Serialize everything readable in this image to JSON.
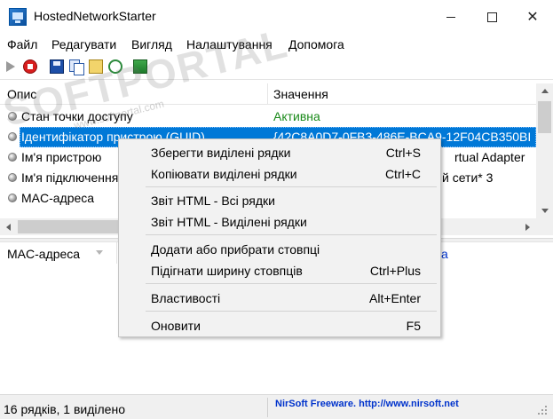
{
  "window": {
    "title": "HostedNetworkStarter",
    "controls": {
      "minimize": "minimize",
      "maximize": "maximize",
      "close": "close"
    }
  },
  "menu": {
    "items": [
      "Файл",
      "Редагувати",
      "Вигляд",
      "Налаштування",
      "Допомога"
    ]
  },
  "toolbar": {
    "icons": [
      "play-icon",
      "stop-icon",
      "save-icon",
      "copy-icon",
      "properties-icon",
      "refresh-icon",
      "exit-icon"
    ]
  },
  "list": {
    "columns": [
      "Опис",
      "Значення"
    ],
    "rows": [
      {
        "desc": "Стан точки доступу",
        "value": "Активна"
      },
      {
        "desc": "Ідентифікатор пристрою (GUID)",
        "value": "{42C8A0D7-0FB3-486E-BCA9-12F04CB350BI"
      },
      {
        "desc": "Ім'я пристрою",
        "value": "rtual Adapter"
      },
      {
        "desc": "Ім'я підключення",
        "value": "й сети* 3"
      },
      {
        "desc": "MAC-адреса",
        "value": ""
      }
    ],
    "status_color": "#1a8a1a",
    "selected_color": "#0078d7"
  },
  "lower_list": {
    "column": "MAC-адреса",
    "link_fragment": "a"
  },
  "context_menu": {
    "items": [
      {
        "label": "Зберегти виділені рядки",
        "shortcut": "Ctrl+S"
      },
      {
        "label": "Копіювати виділені рядки",
        "shortcut": "Ctrl+C"
      },
      {
        "label": "Звіт HTML - Всі рядки",
        "shortcut": ""
      },
      {
        "label": "Звіт HTML - Виділені рядки",
        "shortcut": ""
      },
      {
        "label": "Додати або прибрати стовпці",
        "shortcut": ""
      },
      {
        "label": "Підігнати ширину стовпців",
        "shortcut": "Ctrl+Plus"
      },
      {
        "label": "Властивості",
        "shortcut": "Alt+Enter"
      },
      {
        "label": "Оновити",
        "shortcut": "F5"
      }
    ]
  },
  "statusbar": {
    "left": "16 рядків, 1 виділено",
    "right": "NirSoft Freeware.  http://www.nirsoft.net"
  },
  "watermark": {
    "main": "SOFTPORTAL",
    "sub": "www.softportal.com"
  }
}
